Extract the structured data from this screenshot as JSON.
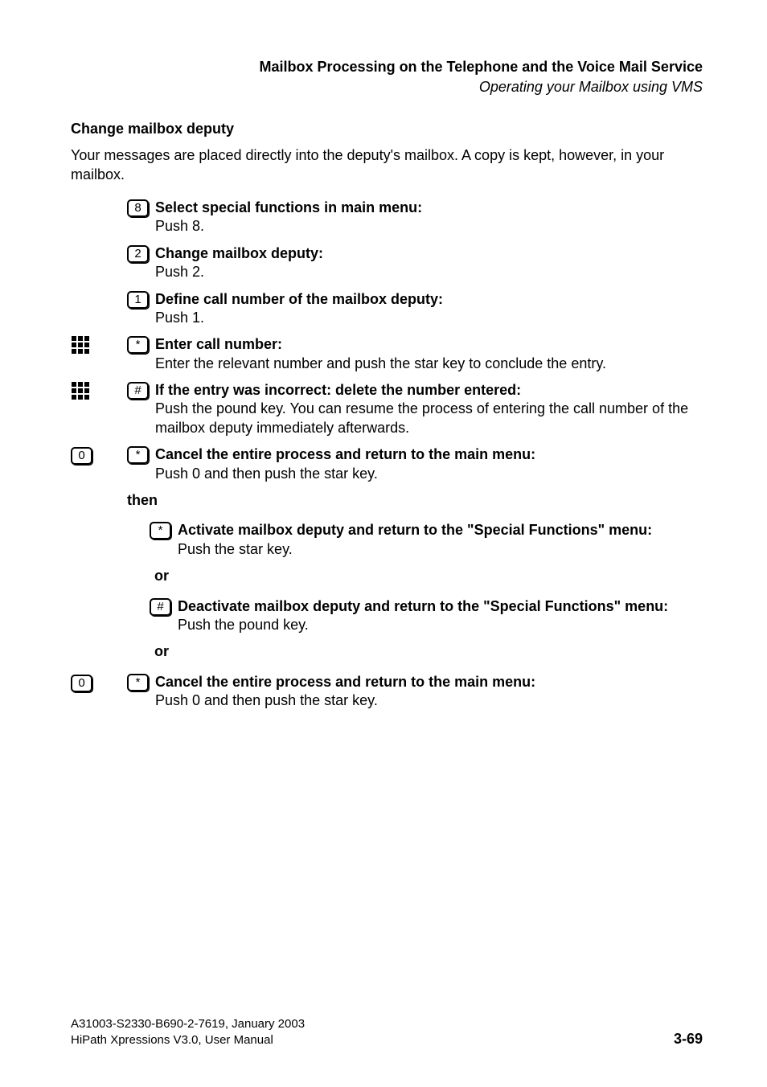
{
  "header": {
    "title": "Mailbox Processing on the Telephone and the Voice Mail Service",
    "subtitle": "Operating your Mailbox using VMS"
  },
  "section": {
    "title": "Change mailbox deputy",
    "intro": "Your messages are placed directly into the deputy's mailbox. A copy is kept, however, in your mailbox."
  },
  "steps": {
    "s1": {
      "key": "8",
      "title": "Select special functions in main menu:",
      "desc": "Push 8."
    },
    "s2": {
      "key": "2",
      "title": "Change mailbox deputy:",
      "desc": "Push 2."
    },
    "s3": {
      "key": "1",
      "title": "Define call number of the mailbox deputy:",
      "desc": "Push 1."
    },
    "s4": {
      "key": "*",
      "title": "Enter call number:",
      "desc": "Enter the relevant number and push the star key to conclude the entry."
    },
    "s5": {
      "key": "#",
      "title": "If the entry was incorrect: delete the number entered:",
      "desc": "Push the pound key. You can resume the process of entering the call number of the mailbox deputy immediately afterwards."
    },
    "s6": {
      "key0": "0",
      "key": "*",
      "title": "Cancel the entire process and return to the main menu:",
      "desc": "Push 0 and then push the star key."
    },
    "then": "then",
    "s7": {
      "key": "*",
      "title": "Activate mailbox deputy and return to the \"Special Functions\" menu:",
      "desc": "Push the star key."
    },
    "or1": "or",
    "s8": {
      "key": "#",
      "title": "Deactivate mailbox deputy and return to the \"Special Functions\" menu:",
      "desc": "Push the pound key."
    },
    "or2": "or",
    "s9": {
      "key0": "0",
      "key": "*",
      "title": "Cancel the entire process and return to the main menu:",
      "desc": "Push 0 and then push the star key."
    }
  },
  "footer": {
    "line1": "A31003-S2330-B690-2-7619, January 2003",
    "line2": "HiPath Xpressions V3.0, User Manual",
    "page": "3-69"
  }
}
